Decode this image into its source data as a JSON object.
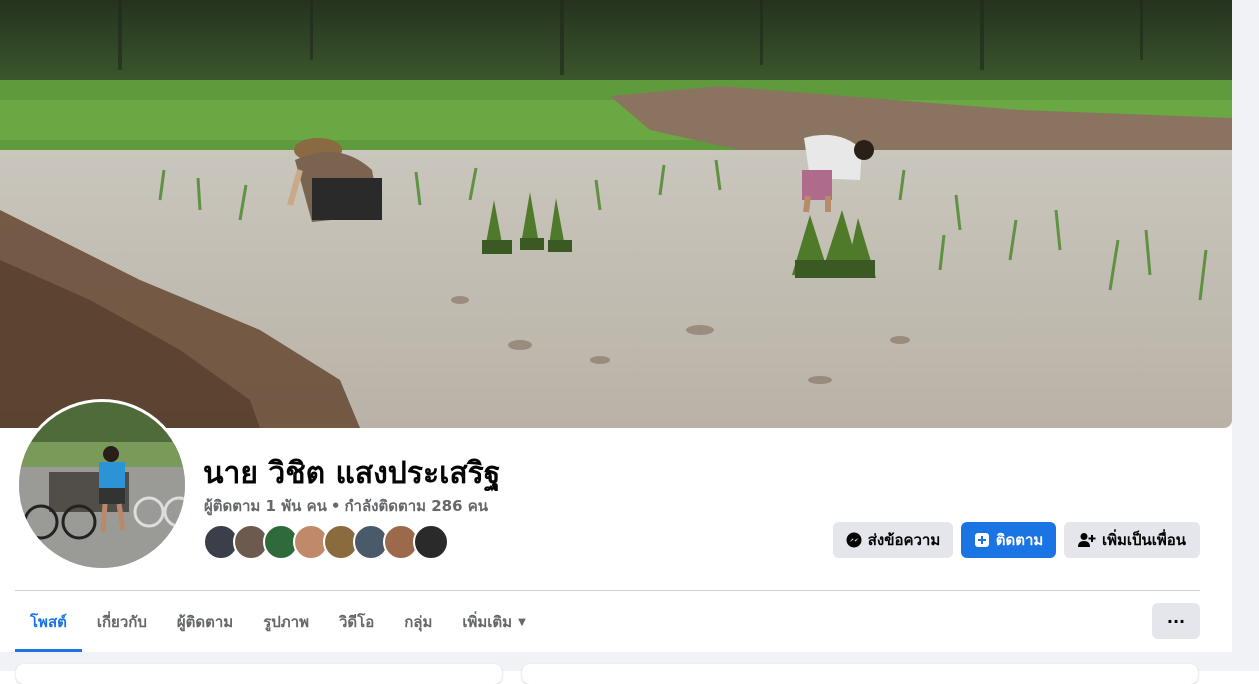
{
  "profile": {
    "name": "นาย วิชิต แสงประเสริฐ",
    "followers": "ผู้ติดตาม 1 พัน คน",
    "separator": "•",
    "following": "กำลังติดตาม 286 คน"
  },
  "friends_preview": [
    {
      "color": "#3a3f4a"
    },
    {
      "color": "#6d5a4e"
    },
    {
      "color": "#2f6b3a"
    },
    {
      "color": "#c08a6a"
    },
    {
      "color": "#8a6b3e"
    },
    {
      "color": "#4a5a6a"
    },
    {
      "color": "#9a6a4a"
    },
    {
      "color": "#2a2a2a"
    }
  ],
  "actions": {
    "message_label": "ส่งข้อความ",
    "follow_label": "ติดตาม",
    "add_friend_label": "เพิ่มเป็นเพื่อน"
  },
  "tabs": [
    {
      "label": "โพสต์",
      "active": true
    },
    {
      "label": "เกี่ยวกับ"
    },
    {
      "label": "ผู้ติดตาม"
    },
    {
      "label": "รูปภาพ"
    },
    {
      "label": "วิดีโอ"
    },
    {
      "label": "กลุ่ม"
    },
    {
      "label": "เพิ่มเติม"
    }
  ],
  "more_button": "···",
  "colors": {
    "accent": "#1b74e4",
    "secondary_text": "#65676b",
    "button_grey": "#e4e6eb",
    "page_background": "#f0f2f5"
  },
  "icons": {
    "message": "messenger-icon",
    "follow": "follow-icon",
    "add_friend": "add-friend-icon",
    "tab_more": "caret-down-icon"
  }
}
